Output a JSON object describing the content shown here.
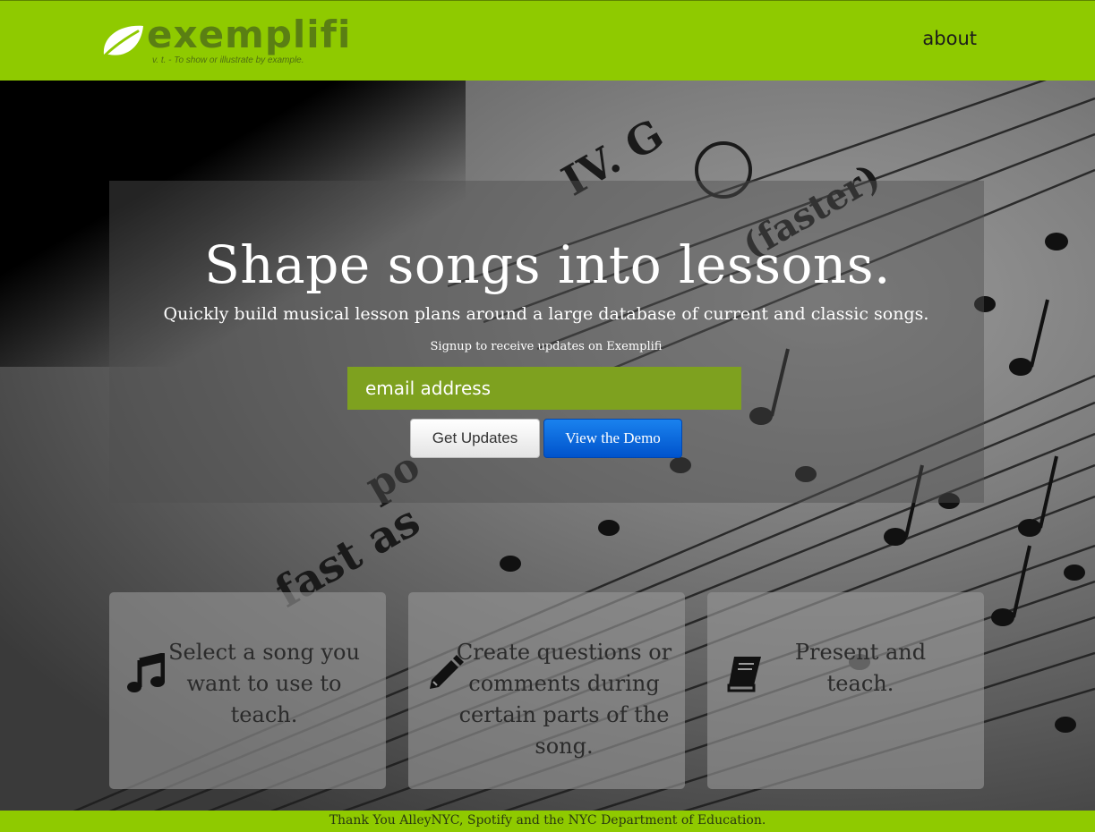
{
  "brand": {
    "name": "exemplifi",
    "tagline": "v. t. - To show or illustrate by example.",
    "logo_icon": "leaf-icon",
    "brand_color": "#8fca00"
  },
  "nav": {
    "about_label": "about"
  },
  "hero": {
    "headline": "Shape songs into lessons.",
    "subheadline": "Quickly build musical lesson plans around a large database of current and classic songs.",
    "signup_note": "Signup to receive updates on Exemplifi",
    "email_placeholder": "email address",
    "get_updates_label": "Get Updates",
    "view_demo_label": "View the Demo"
  },
  "features": [
    {
      "icon": "music-note-icon",
      "text": "Select a song you want to use to teach."
    },
    {
      "icon": "pencil-icon",
      "text": "Create questions or comments during certain parts of the song."
    },
    {
      "icon": "book-icon",
      "text": "Present and teach."
    }
  ],
  "footer": {
    "text": "Thank You AlleyNYC, Spotify and the NYC Department of Education."
  }
}
